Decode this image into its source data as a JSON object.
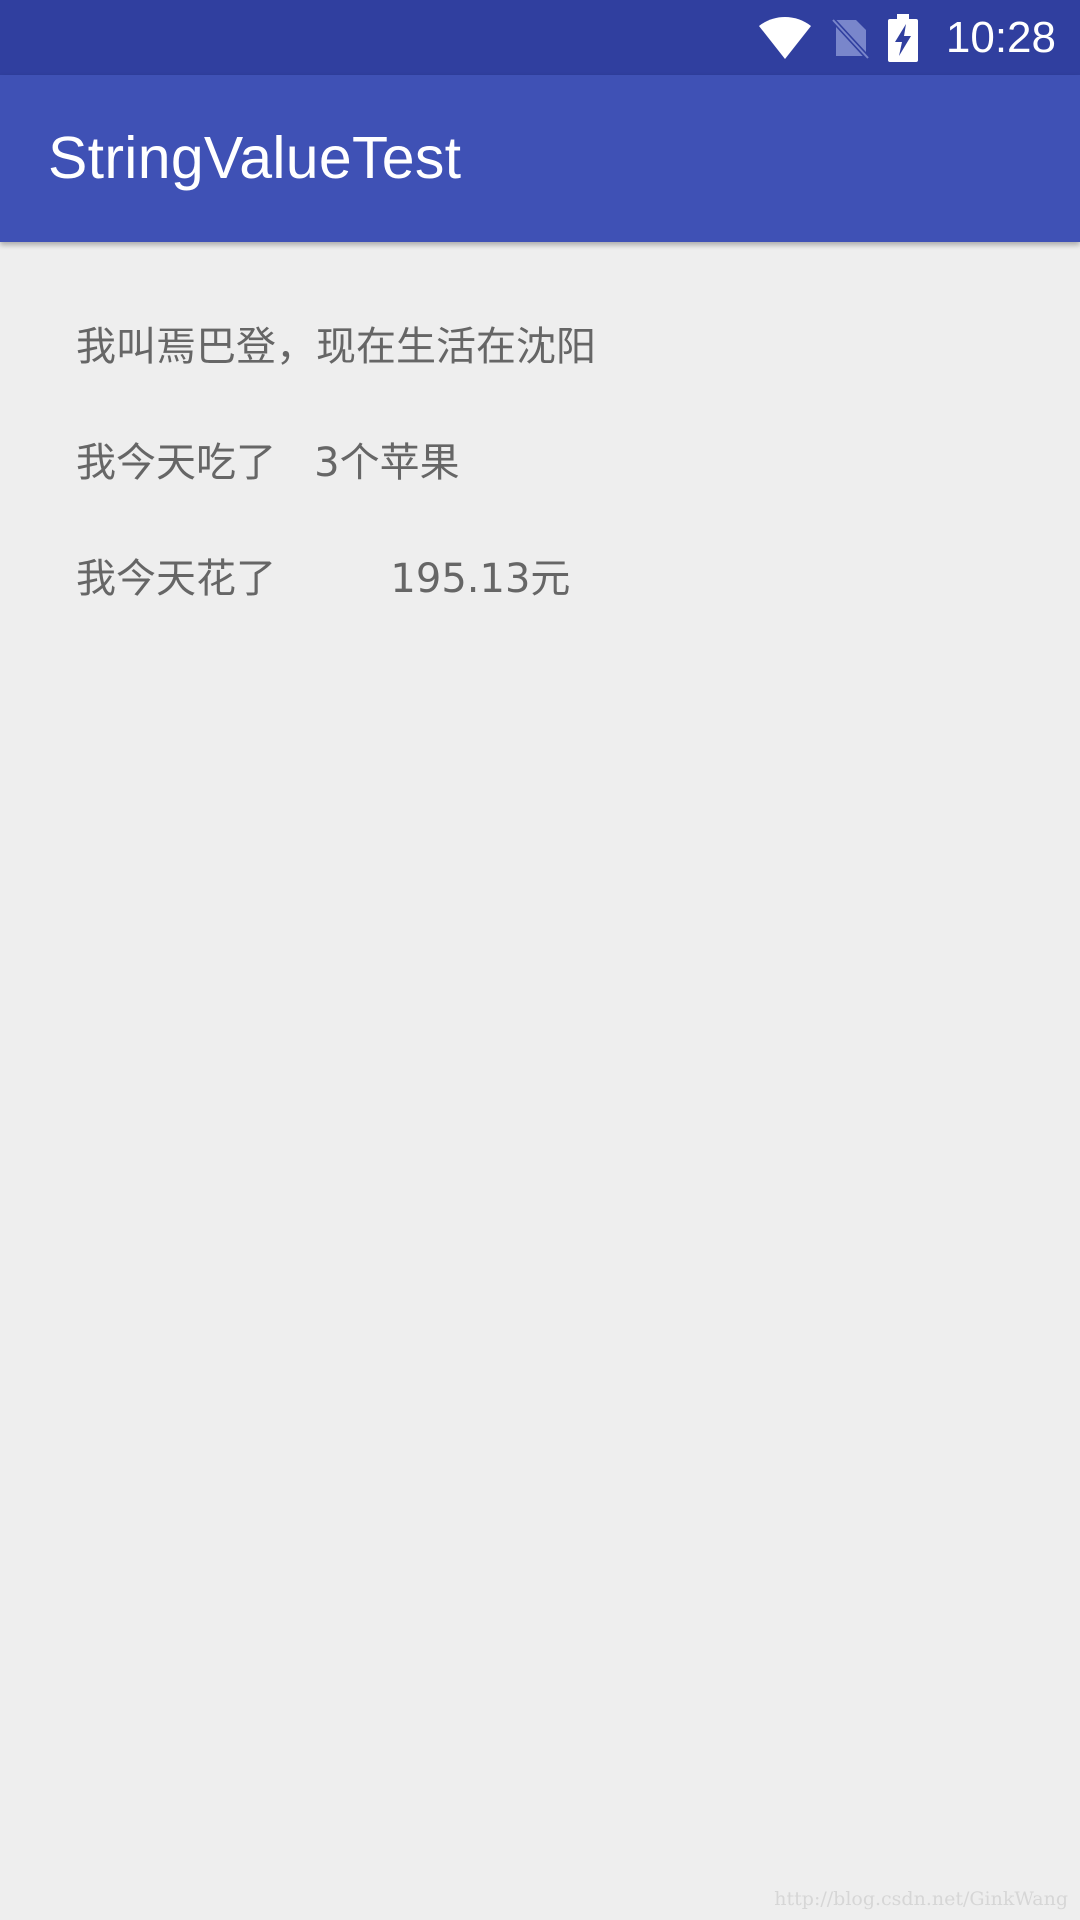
{
  "status_bar": {
    "time": "10:28",
    "icons": [
      "wifi-icon",
      "no-sim-icon",
      "battery-charging-icon"
    ]
  },
  "app_bar": {
    "title": "StringValueTest"
  },
  "content": {
    "lines": [
      "我叫焉巴登，现在生活在沈阳",
      "我今天吃了   3个苹果",
      "我今天花了         195.13元"
    ]
  },
  "watermark": "http://blog.csdn.net/GinkWang",
  "colors": {
    "status_bar": "#303f9f",
    "app_bar": "#3f51b5",
    "background": "#eeeeee",
    "text": "#666666"
  }
}
